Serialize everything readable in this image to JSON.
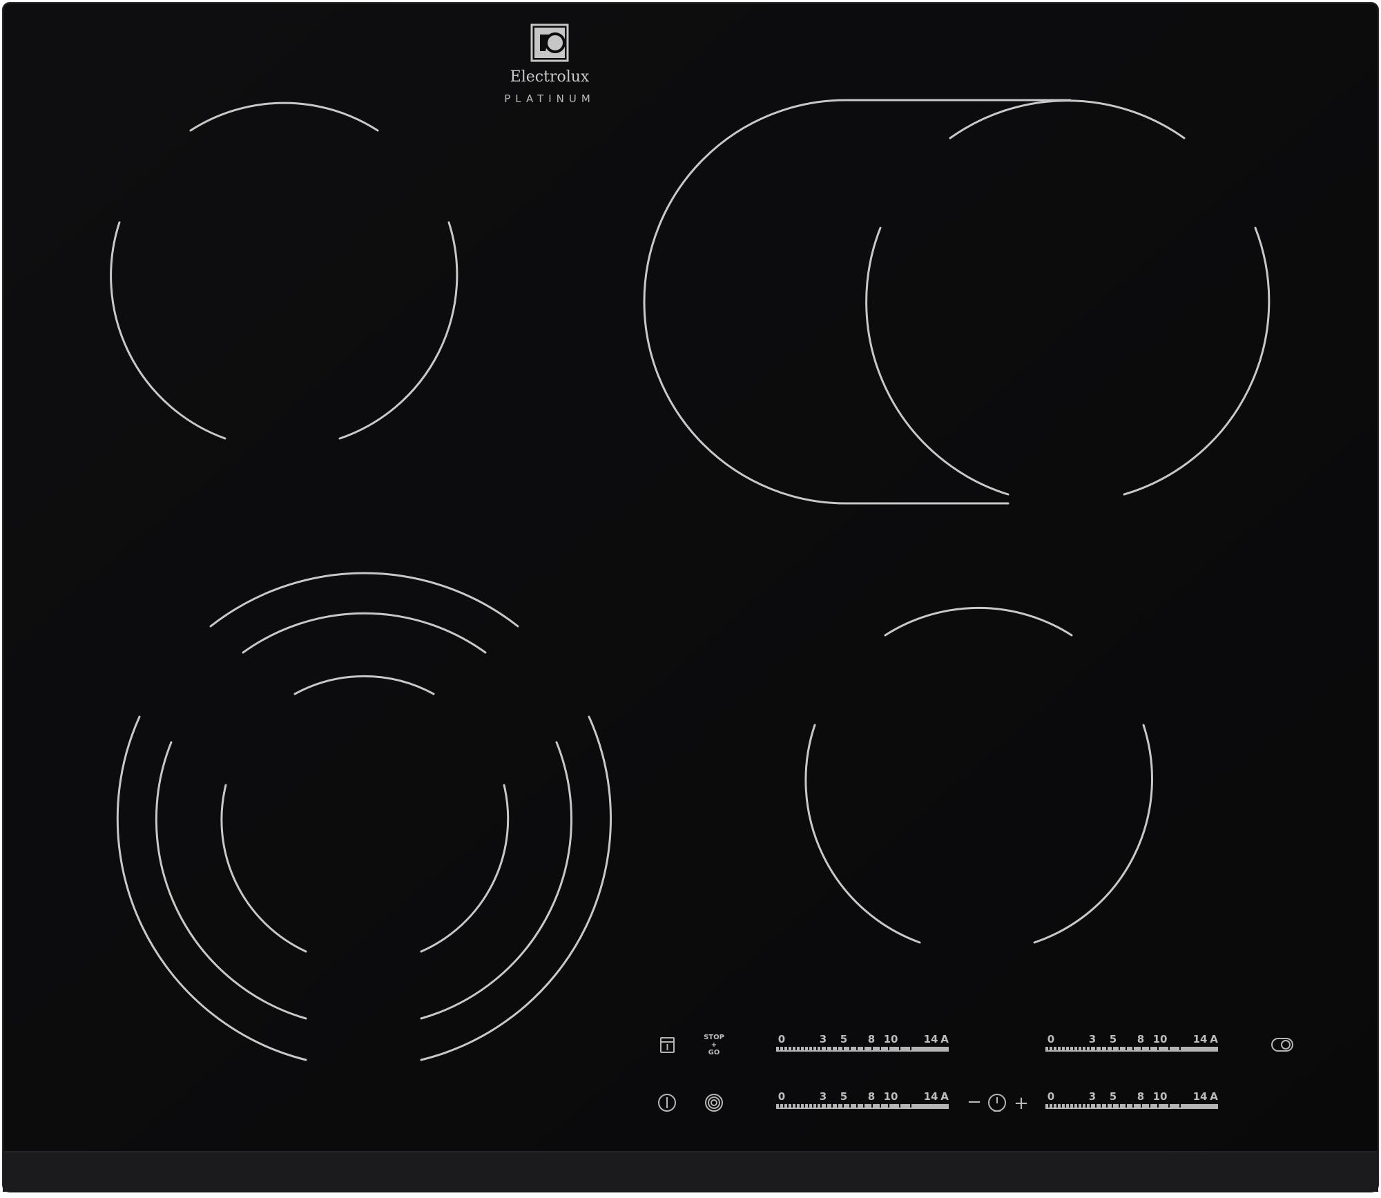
{
  "brand": {
    "name": "Electrolux",
    "series": "PLATINUM",
    "logo_icon": "electrolux-logo-icon"
  },
  "colors": {
    "glass": "#0b0b0c",
    "trim": "#1c1c1e",
    "markings": "#c8c8c8"
  },
  "controls": {
    "top_row": {
      "lock_icon": "child-lock-icon",
      "stop_go": {
        "line1": "STOP",
        "line2": "+",
        "line3": "GO"
      },
      "slider_front_left": {
        "labels": [
          "0",
          "3",
          "5",
          "8",
          "10",
          "14",
          "A"
        ]
      },
      "slider_rear_right": {
        "labels": [
          "0",
          "3",
          "5",
          "8",
          "10",
          "14",
          "A"
        ]
      },
      "bridge_icon": "bridge-zone-toggle-icon"
    },
    "bottom_row": {
      "power_icon": "power-icon",
      "zone_icon": "extended-zone-icon",
      "slider_rear_left": {
        "labels": [
          "0",
          "3",
          "5",
          "8",
          "10",
          "14",
          "A"
        ]
      },
      "timer": {
        "minus": "−",
        "plus": "+",
        "icon": "timer-clock-icon"
      },
      "slider_front_right": {
        "labels": [
          "0",
          "3",
          "5",
          "8",
          "10",
          "14",
          "A"
        ]
      }
    }
  }
}
